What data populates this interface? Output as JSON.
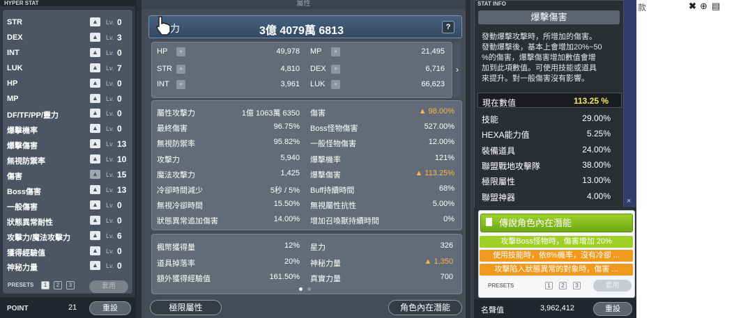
{
  "hyper": {
    "title": "HYPER STAT",
    "lv_label": "Lv.",
    "rows": [
      {
        "name": "STR",
        "value": "0",
        "dim": false
      },
      {
        "name": "DEX",
        "value": "3",
        "dim": false
      },
      {
        "name": "INT",
        "value": "0",
        "dim": false
      },
      {
        "name": "LUK",
        "value": "7",
        "dim": false
      },
      {
        "name": "HP",
        "value": "0",
        "dim": false
      },
      {
        "name": "MP",
        "value": "0",
        "dim": false
      },
      {
        "name": "DF/TF/PP/靈力",
        "value": "0",
        "dim": false
      },
      {
        "name": "爆擊機率",
        "value": "0",
        "dim": false
      },
      {
        "name": "爆擊傷害",
        "value": "13",
        "dim": false
      },
      {
        "name": "無視防禦率",
        "value": "10",
        "dim": false
      },
      {
        "name": "傷害",
        "value": "15",
        "dim": true
      },
      {
        "name": "Boss傷害",
        "value": "13",
        "dim": false
      },
      {
        "name": "一般傷害",
        "value": "0",
        "dim": false
      },
      {
        "name": "狀態異常耐性",
        "value": "0",
        "dim": false
      },
      {
        "name": "攻擊力/魔法攻擊力",
        "value": "6",
        "dim": false
      },
      {
        "name": "獲得經驗值",
        "value": "0",
        "dim": false
      },
      {
        "name": "神秘力量",
        "value": "0",
        "dim": false
      }
    ],
    "presets_label": "PRESETS",
    "presets": [
      "1",
      "2",
      "3"
    ],
    "apply_label": "套用",
    "point_label": "POINT",
    "point_value": "21",
    "reset_label": "重設"
  },
  "stats": {
    "header": "屬性",
    "power_label": "戰鬥力",
    "power_label_visible": "力",
    "power_value": "3億 4079萬 6813",
    "help": "?",
    "basic_left": [
      {
        "label": "HP",
        "value": "49,978"
      },
      {
        "label": "STR",
        "value": "4,810"
      },
      {
        "label": "INT",
        "value": "3,961"
      }
    ],
    "basic_right": [
      {
        "label": "MP",
        "value": "21,495"
      },
      {
        "label": "DEX",
        "value": "6,716"
      },
      {
        "label": "LUK",
        "value": "66,623"
      }
    ],
    "detail_left": [
      {
        "label": "屬性攻擊力",
        "value": "1億 1063萬 6350"
      },
      {
        "label": "最終傷害",
        "value": "96.75%"
      },
      {
        "label": "無視防禦率",
        "value": "95.82%"
      },
      {
        "label": "攻擊力",
        "value": "5,940"
      },
      {
        "label": "魔法攻擊力",
        "value": "1,425"
      },
      {
        "label": "冷卻時間減少",
        "value": "5秒 / 5%"
      },
      {
        "label": "無視冷卻時間",
        "value": "15.50%"
      },
      {
        "label": "狀態異常追加傷害",
        "value": "14.00%"
      }
    ],
    "detail_right": [
      {
        "label": "傷害",
        "value": "▲ 98.00%",
        "highlight": true
      },
      {
        "label": "Boss怪物傷害",
        "value": "527.00%",
        "highlight": false
      },
      {
        "label": "一般怪物傷害",
        "value": "12.00%",
        "highlight": false
      },
      {
        "label": "爆擊機率",
        "value": "121%",
        "highlight": false
      },
      {
        "label": "爆擊傷害",
        "value": "▲ 113.25%",
        "highlight": true
      },
      {
        "label": "Buff持續時間",
        "value": "68%",
        "highlight": false
      },
      {
        "label": "無視屬性抗性",
        "value": "5.00%",
        "highlight": false
      },
      {
        "label": "增加召喚獸持續時間",
        "value": "0%",
        "highlight": false
      }
    ],
    "misc_left": [
      {
        "label": "楓幣獲得量",
        "value": "12%"
      },
      {
        "label": "道具掉落率",
        "value": "20%"
      },
      {
        "label": "額外獲得經驗值",
        "value": "161.50%"
      }
    ],
    "misc_right": [
      {
        "label": "星力",
        "value": "326",
        "highlight": false
      },
      {
        "label": "神秘力量",
        "value": "▲ 1,350",
        "highlight": true
      },
      {
        "label": "真實力量",
        "value": "700",
        "highlight": false
      }
    ],
    "btn_limit": "極限屬性",
    "btn_inner": "角色內在潛能",
    "expand_arrow": "›"
  },
  "info": {
    "header": "STAT INFO",
    "title": "爆擊傷害",
    "desc": "發動爆擊攻擊時，所增加的傷害。\n發動爆擊後，基本上會增加20%~50\n%的傷害，爆擊傷害增加數值會增\n加到此項數值。可使用技能或道具\n來提升。對一般傷害沒有影響。",
    "current_label": "現在數值",
    "current_value": "113.25 %",
    "rows": [
      {
        "label": "技能",
        "value": "29.00%"
      },
      {
        "label": "HEXA能力值",
        "value": "5.25%"
      },
      {
        "label": "裝備道具",
        "value": "24.00%"
      },
      {
        "label": "聯盟戰地攻擊隊",
        "value": "38.00%"
      },
      {
        "label": "極限屬性",
        "value": "13.00%"
      },
      {
        "label": "聯盟神器",
        "value": "4.00%"
      }
    ]
  },
  "inner": {
    "title": "傳說角色內在潛能",
    "lines": [
      {
        "text": "攻擊Boss怪物時，傷害增加 20%",
        "kind": "g"
      },
      {
        "text": "使用技能時，依8%機率，沒有冷卻 ...",
        "kind": "o"
      },
      {
        "text": "攻擊陷入狀態異常的對象時，傷害 ...",
        "kind": "o"
      }
    ],
    "presets_label": "PRESETS",
    "presets": [
      "1",
      "2",
      "3"
    ],
    "apply_label": "套用",
    "fame_label": "名聲值",
    "fame_value": "3,962,412",
    "reset_label": "重設",
    "close": "×"
  },
  "browser": {
    "partial_text": "款",
    "icons": [
      "close-x-icon",
      "download-circle-icon",
      "document-icon"
    ]
  },
  "colors": {
    "highlight": "#ffb648",
    "current": "#f4e95f",
    "green": "#a0cf28",
    "orange": "#ef9a1c"
  }
}
